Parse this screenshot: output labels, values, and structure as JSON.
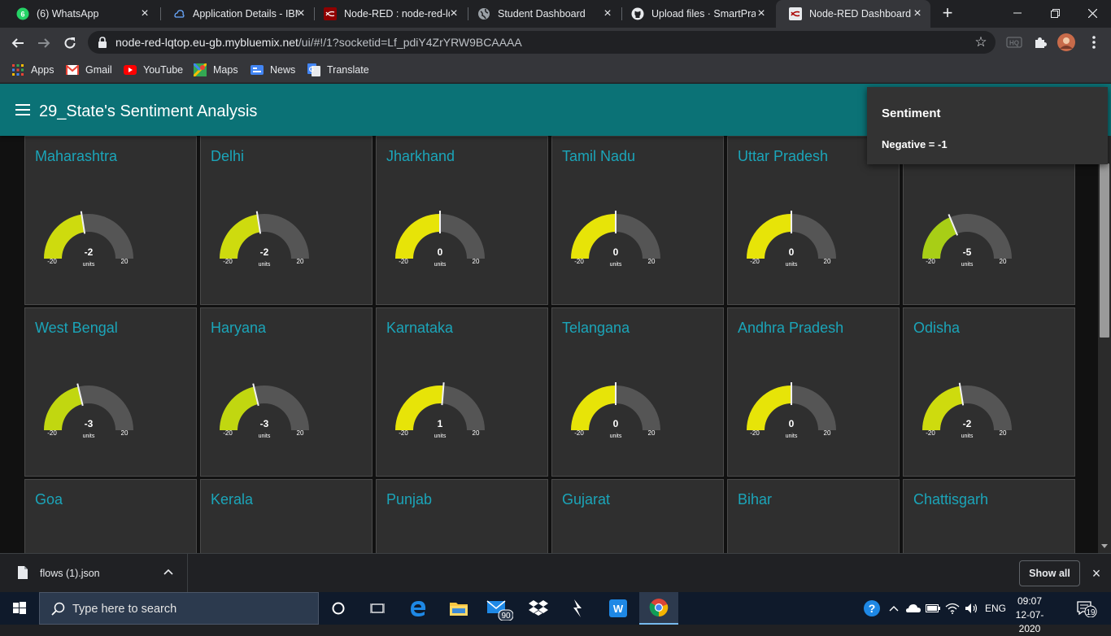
{
  "browser": {
    "tabs": [
      {
        "label": "(6) WhatsApp",
        "icon": "whatsapp-icon",
        "badge": "6"
      },
      {
        "label": "Application Details - IBM",
        "icon": "ibm-cloud-icon"
      },
      {
        "label": "Node-RED : node-red-lq",
        "icon": "node-red-icon"
      },
      {
        "label": "Student Dashboard",
        "icon": "globe-icon"
      },
      {
        "label": "Upload files · SmartPrac",
        "icon": "github-icon"
      },
      {
        "label": "Node-RED Dashboard",
        "icon": "node-red-icon"
      }
    ],
    "url_host": "node-red-lqtop.eu-gb.mybluemix.net",
    "url_path": "/ui/#!/1?socketid=Lf_pdiY4ZrYRW9BCAAAA",
    "bookmarks": [
      {
        "label": "Apps"
      },
      {
        "label": "Gmail"
      },
      {
        "label": "YouTube"
      },
      {
        "label": "Maps"
      },
      {
        "label": "News"
      },
      {
        "label": "Translate"
      }
    ]
  },
  "dashboard": {
    "title": "29_State's Sentiment Analysis",
    "accent_color": "#0b7276",
    "label_color": "#1ba5b9",
    "toast": {
      "title": "Sentiment",
      "message": "Negative = -1"
    },
    "gauge_min_label": "-20",
    "gauge_max_label": "20",
    "gauge_units": "units",
    "states": [
      {
        "name": "Maharashtra",
        "value": "-2"
      },
      {
        "name": "Delhi",
        "value": "-2"
      },
      {
        "name": "Jharkhand",
        "value": "0"
      },
      {
        "name": "Tamil Nadu",
        "value": "0"
      },
      {
        "name": "Uttar Pradesh",
        "value": "0"
      },
      {
        "name": "",
        "value": "-5"
      },
      {
        "name": "West Bengal",
        "value": "-3"
      },
      {
        "name": "Haryana",
        "value": "-3"
      },
      {
        "name": "Karnataka",
        "value": "1"
      },
      {
        "name": "Telangana",
        "value": "0"
      },
      {
        "name": "Andhra Pradesh",
        "value": "0"
      },
      {
        "name": "Odisha",
        "value": "-2"
      },
      {
        "name": "Goa",
        "value": ""
      },
      {
        "name": "Kerala",
        "value": ""
      },
      {
        "name": "Punjab",
        "value": ""
      },
      {
        "name": "Gujarat",
        "value": ""
      },
      {
        "name": "Bihar",
        "value": ""
      },
      {
        "name": "Chattisgarh",
        "value": ""
      }
    ]
  },
  "downloads": {
    "file": "flows (1).json",
    "show_all": "Show all"
  },
  "taskbar": {
    "search_placeholder": "Type here to search",
    "mail_badge": "90",
    "language": "ENG",
    "time": "09:07",
    "date": "12-07-2020",
    "notification_count": "19"
  }
}
